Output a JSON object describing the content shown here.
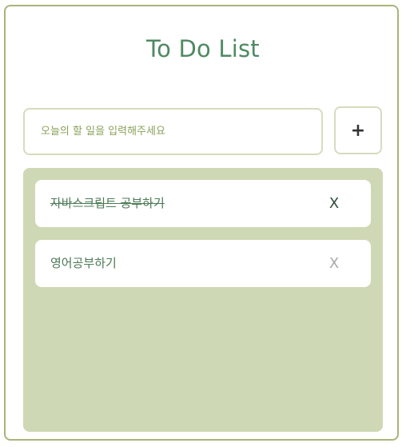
{
  "title": "To Do List",
  "input": {
    "value": "",
    "placeholder": "오늘의 할 일을 입력해주세요"
  },
  "add_button": {
    "label": "+"
  },
  "todos": [
    {
      "text": "자바스크립트 공부하기",
      "completed": true,
      "delete_label": "X",
      "delete_color": "#2f4a3a"
    },
    {
      "text": "영어공부하기",
      "completed": false,
      "delete_label": "X",
      "delete_color": "#a9a9a9"
    }
  ],
  "colors": {
    "accent": "#4e8a62",
    "border": "#a8b47a",
    "panel": "#cfd8b4"
  }
}
